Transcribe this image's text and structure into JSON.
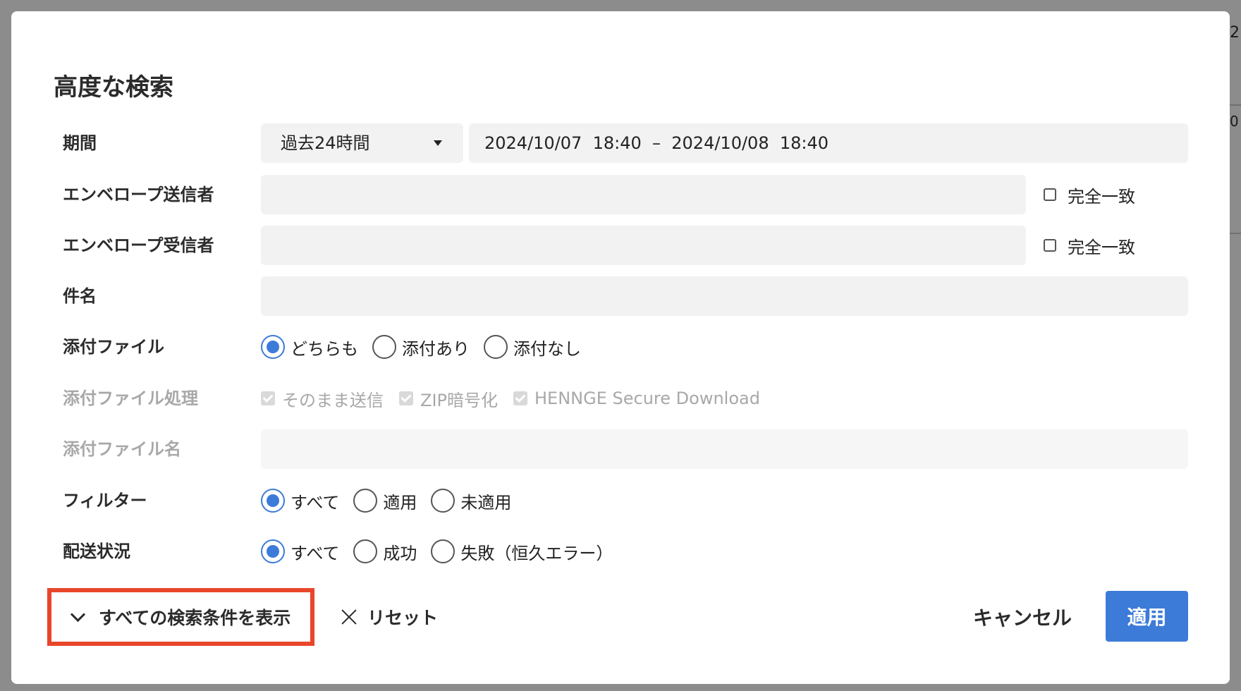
{
  "backdrop": {
    "right_text_1": "2",
    "right_text_2": "0"
  },
  "modal": {
    "title": "高度な検索",
    "period": {
      "label": "期間",
      "preset": "過去24時間",
      "range": "2024/10/07  18:40  –  2024/10/08  18:40"
    },
    "envelope_sender": {
      "label": "エンベロープ送信者",
      "value": "",
      "exact_label": "完全一致",
      "exact_checked": false
    },
    "envelope_recipient": {
      "label": "エンベロープ受信者",
      "value": "",
      "exact_label": "完全一致",
      "exact_checked": false
    },
    "subject": {
      "label": "件名",
      "value": ""
    },
    "attachment": {
      "label": "添付ファイル",
      "options": [
        "どちらも",
        "添付あり",
        "添付なし"
      ],
      "selected": "どちらも"
    },
    "attachment_processing": {
      "label": "添付ファイル処理",
      "options": [
        "そのまま送信",
        "ZIP暗号化",
        "HENNGE Secure Download"
      ],
      "all_checked": true,
      "disabled": true
    },
    "attachment_name": {
      "label": "添付ファイル名",
      "value": "",
      "disabled": true
    },
    "filter": {
      "label": "フィルター",
      "options": [
        "すべて",
        "適用",
        "未適用"
      ],
      "selected": "すべて"
    },
    "delivery_status": {
      "label": "配送状況",
      "options": [
        "すべて",
        "成功",
        "失敗（恒久エラー）"
      ],
      "selected": "すべて"
    },
    "footer": {
      "show_all_label": "すべての検索条件を表示",
      "reset_label": "リセット",
      "cancel_label": "キャンセル",
      "apply_label": "適用"
    }
  },
  "colors": {
    "accent": "#3d7bd8",
    "highlight_border": "#e8462b",
    "field_bg": "#f2f2f2",
    "disabled_text": "#a8a8a8"
  }
}
